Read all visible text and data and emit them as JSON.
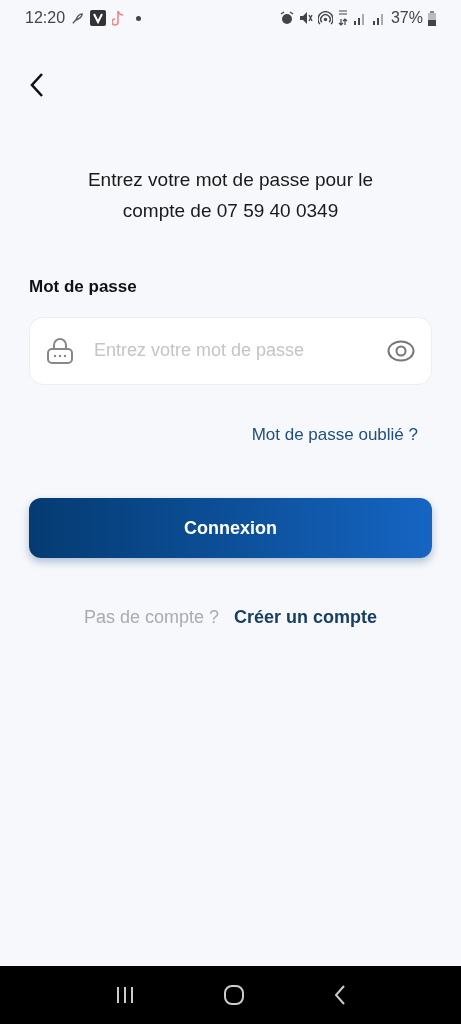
{
  "status_bar": {
    "time": "12:20",
    "battery": "37%"
  },
  "prompt": "Entrez votre mot de passe pour le compte de 07 59 40 0349",
  "password_field": {
    "label": "Mot de passe",
    "placeholder": "Entrez votre mot de passe"
  },
  "forgot_link": "Mot de passe oublié ?",
  "login_button": "Connexion",
  "signup": {
    "text": "Pas de compte ?",
    "link": "Créer un compte"
  }
}
